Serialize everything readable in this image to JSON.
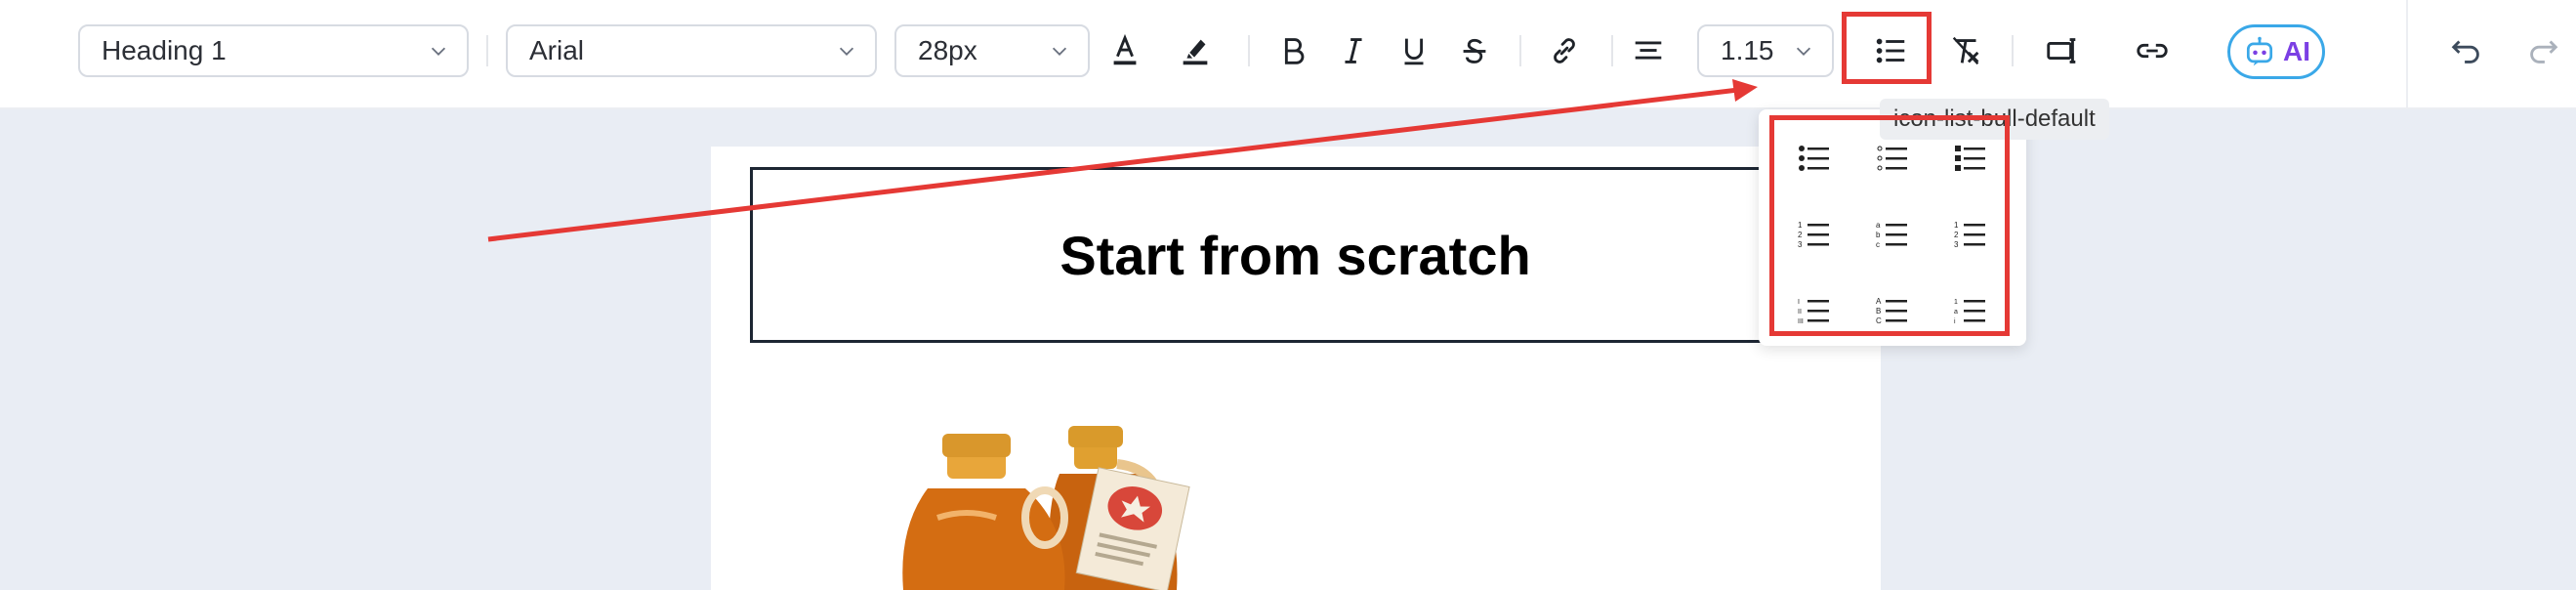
{
  "toolbar": {
    "block_style": "Heading 1",
    "font_family": "Arial",
    "font_size": "28px",
    "line_height": "1.15",
    "ai_label": "AI"
  },
  "tooltip": "icon-list-bull-default",
  "document": {
    "heading": "Start from scratch"
  },
  "list_options": [
    "bullet-disc",
    "bullet-circle",
    "bullet-square",
    "numbered-decimal",
    "numbered-alpha",
    "numbered-roman",
    "numbered-upper-alpha",
    "numbered-upper-alpha-2",
    "numbered-mixed"
  ],
  "colors": {
    "highlight": "#e53935",
    "ai_border": "#3aa8e8",
    "ai_text": "#7b3fe4",
    "canvas": "#e9edf4"
  },
  "annotation": {
    "arrow_color": "#e53935"
  }
}
